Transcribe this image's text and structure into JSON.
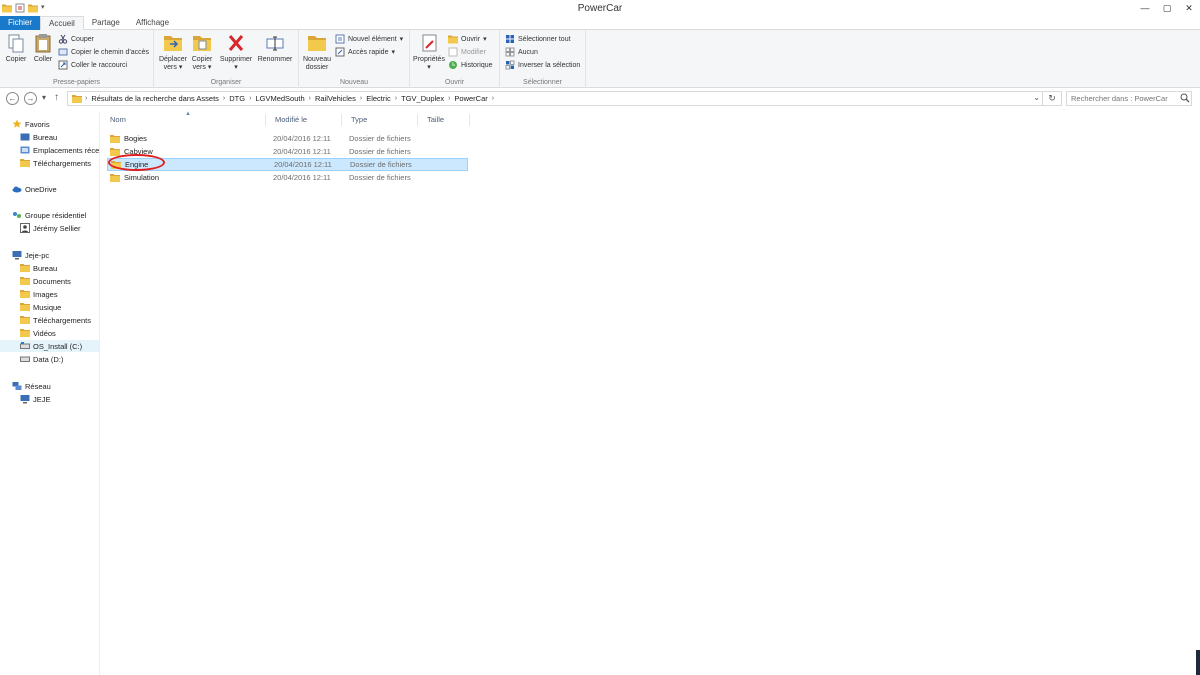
{
  "window": {
    "title": "PowerCar"
  },
  "ribbon_tabs": [
    "Fichier",
    "Accueil",
    "Partage",
    "Affichage"
  ],
  "ribbon": {
    "clipboard": {
      "label": "Presse-papiers",
      "copy": "Copier",
      "paste": "Coller",
      "cut": "Couper",
      "copy_path": "Copier le chemin d'accès",
      "paste_shortcut": "Coller le raccourci"
    },
    "organize": {
      "label": "Organiser",
      "move_to_1": "Déplacer",
      "move_to_2": "vers",
      "copy_to_1": "Copier",
      "copy_to_2": "vers",
      "delete": "Supprimer",
      "rename": "Renommer"
    },
    "new": {
      "label": "Nouveau",
      "new_folder_1": "Nouveau",
      "new_folder_2": "dossier",
      "new_item": "Nouvel élément",
      "easy_access": "Accès rapide"
    },
    "open": {
      "label": "Ouvrir",
      "properties": "Propriétés",
      "open": "Ouvrir",
      "edit": "Modifier",
      "history": "Historique"
    },
    "select": {
      "label": "Sélectionner",
      "select_all": "Sélectionner tout",
      "select_none": "Aucun",
      "invert": "Inverser la sélection"
    }
  },
  "address": {
    "crumbs": [
      "Résultats de la recherche dans Assets",
      "DTG",
      "LGVMedSouth",
      "RailVehicles",
      "Electric",
      "TGV_Duplex",
      "PowerCar"
    ],
    "search_placeholder": "Rechercher dans : PowerCar"
  },
  "navpane": {
    "favorites": "Favoris",
    "fav_items": [
      "Bureau",
      "Emplacements récents",
      "Téléchargements"
    ],
    "onedrive": "OneDrive",
    "homegroup": "Groupe résidentiel",
    "homegroup_user": "Jérémy Sellier",
    "pc": "Jeje-pc",
    "pc_items": [
      "Bureau",
      "Documents",
      "Images",
      "Musique",
      "Téléchargements",
      "Vidéos",
      "OS_Install (C:)",
      "Data (D:)"
    ],
    "network": "Réseau",
    "network_items": [
      "JEJE"
    ]
  },
  "columns": [
    "Nom",
    "Modifié le",
    "Type",
    "Taille"
  ],
  "files": [
    {
      "name": "Bogies",
      "date": "20/04/2016 12:11",
      "type": "Dossier de fichiers"
    },
    {
      "name": "Cabview",
      "date": "20/04/2016 12:11",
      "type": "Dossier de fichiers"
    },
    {
      "name": "Engine",
      "date": "20/04/2016 12:11",
      "type": "Dossier de fichiers"
    },
    {
      "name": "Simulation",
      "date": "20/04/2016 12:11",
      "type": "Dossier de fichiers"
    }
  ],
  "colors": {
    "accent": "#1979ca",
    "selection": "#cce8ff",
    "annotation": "#e02020",
    "folder": "#e8b84a"
  }
}
